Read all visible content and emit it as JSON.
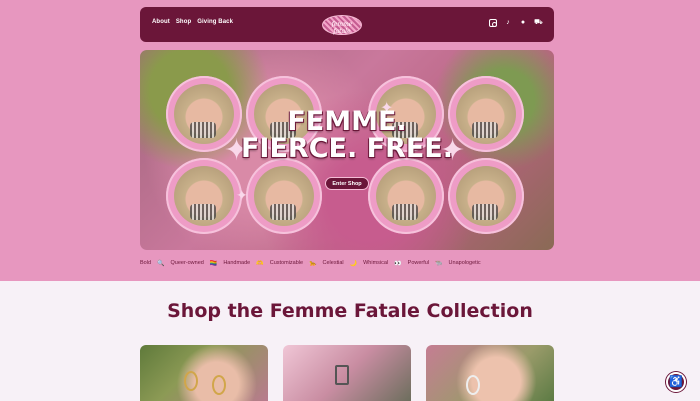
{
  "nav": {
    "items": [
      "About",
      "Shop",
      "Giving Back"
    ]
  },
  "logo": {
    "text": "femme fatale"
  },
  "header_icons": [
    "instagram-icon",
    "tiktok-icon",
    "facebook-icon",
    "cart-icon"
  ],
  "hero": {
    "title_line1": "FEMME.",
    "title_line2": "FIERCE. FREE.",
    "button_label": "Enter Shop"
  },
  "ticker": [
    {
      "text": "Bold",
      "emoji": "🔍"
    },
    {
      "text": "Queer-owned",
      "emoji": "🏳️‍🌈"
    },
    {
      "text": "Handmade",
      "emoji": "🫶"
    },
    {
      "text": "Customizable",
      "emoji": "🐆"
    },
    {
      "text": "Celestial",
      "emoji": "🌙"
    },
    {
      "text": "Whimsical",
      "emoji": "👀"
    },
    {
      "text": "Powerful",
      "emoji": "🐃"
    },
    {
      "text": "Unapologetic",
      "emoji": ""
    }
  ],
  "section": {
    "title": "Shop the Femme Fatale Collection"
  },
  "colors": {
    "brand": "#6b1639",
    "pink": "#e797bf",
    "light": "#f7f1f7"
  }
}
